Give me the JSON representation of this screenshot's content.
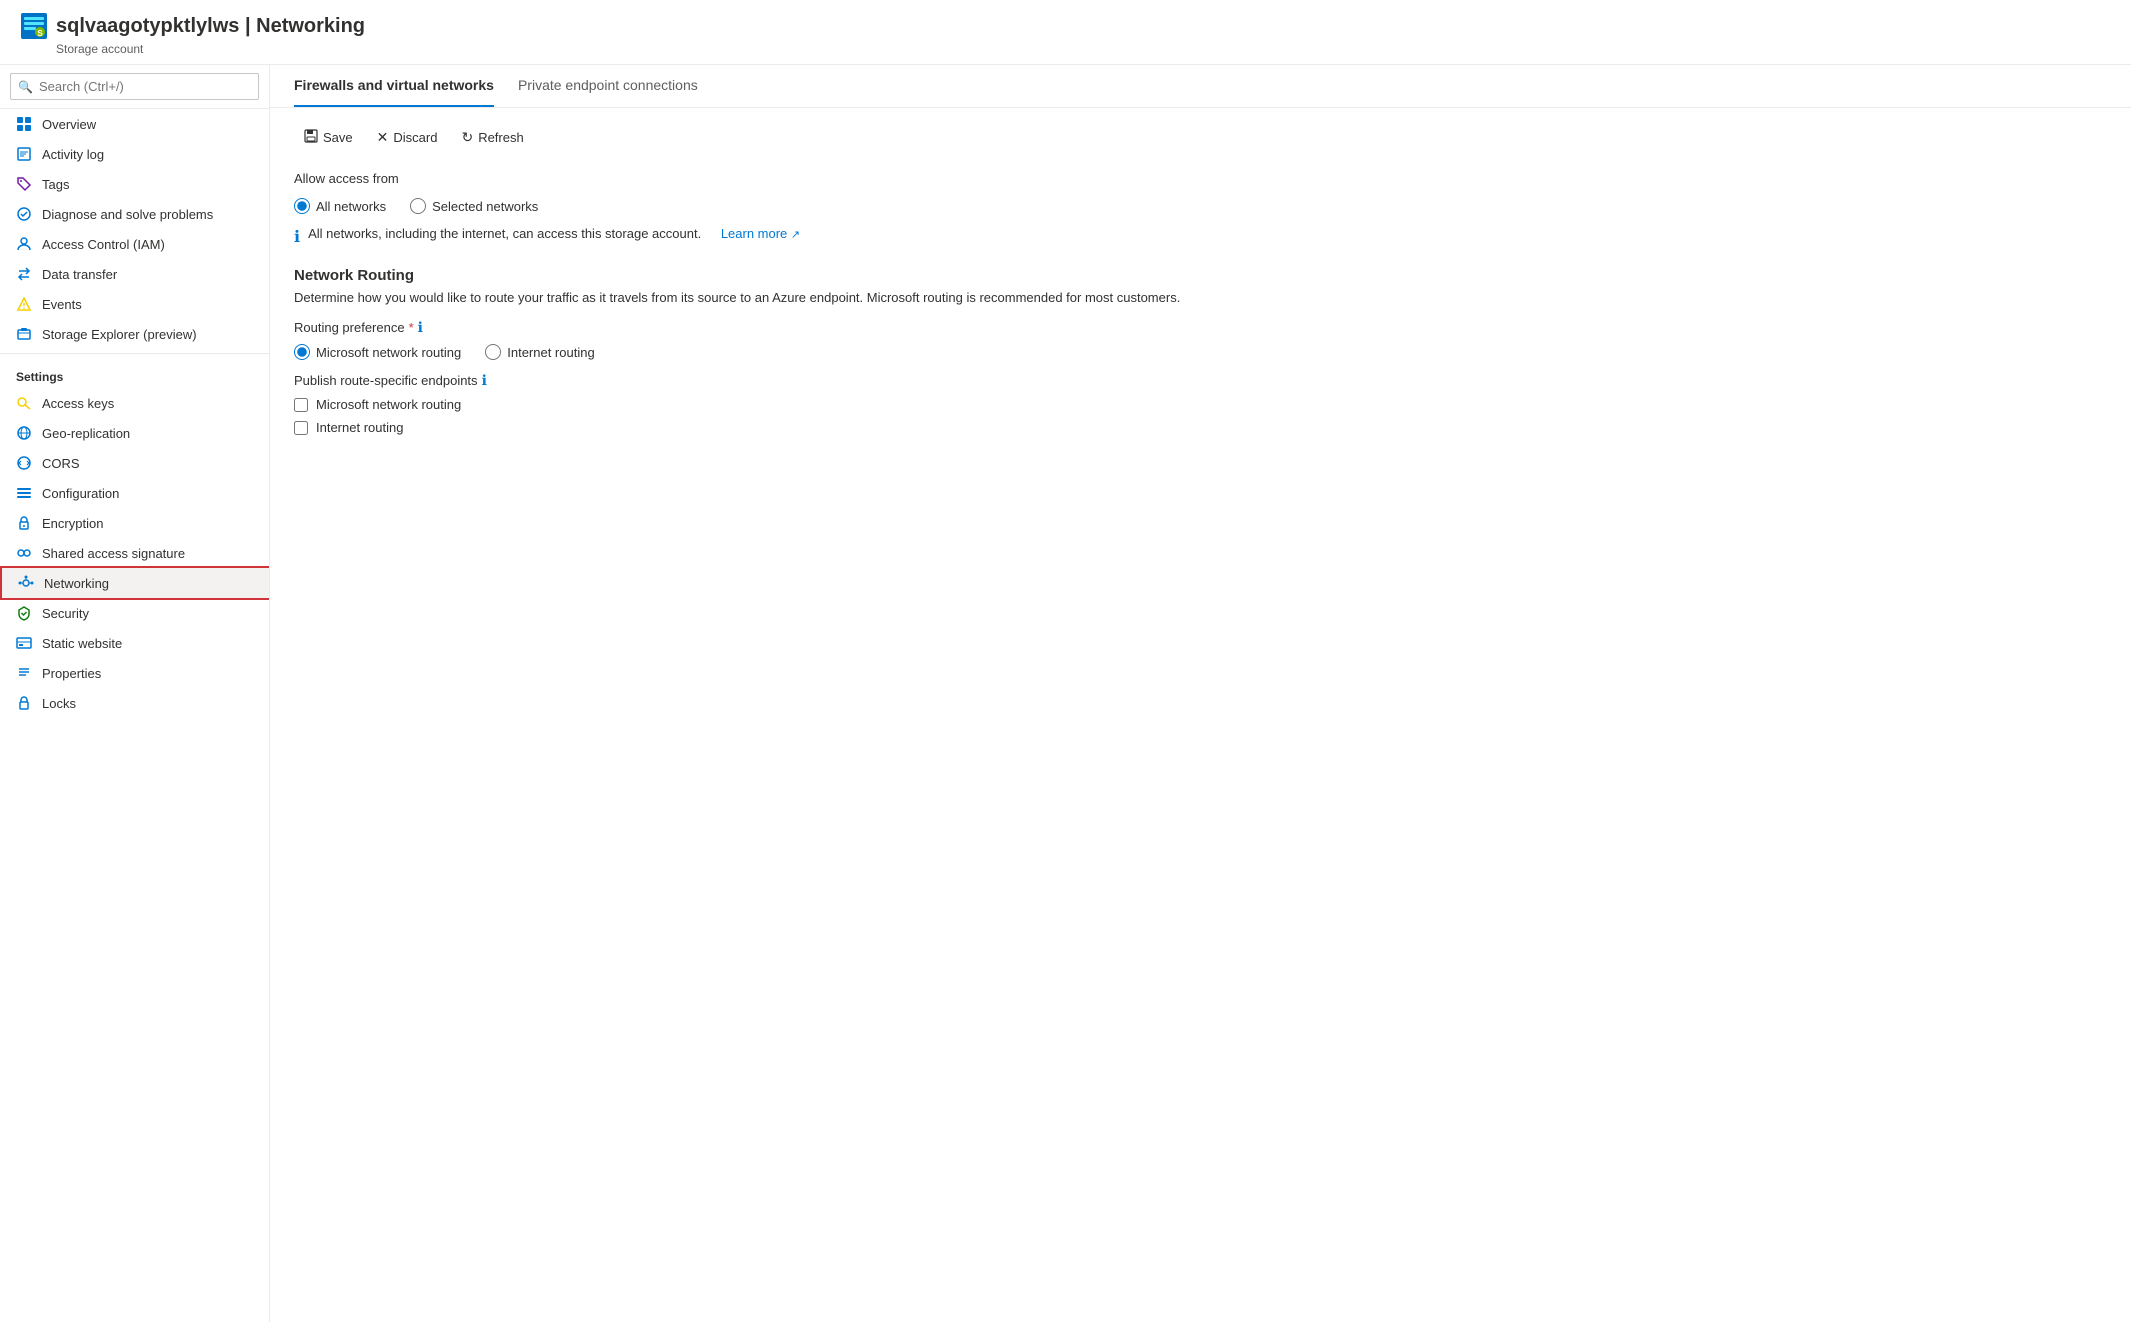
{
  "header": {
    "title": "sqlvaagotypktlylws | Networking",
    "resource_name": "sqlvaagotypktlylws",
    "page_name": "Networking",
    "subtitle": "Storage account",
    "icon": "storage-account"
  },
  "sidebar": {
    "search": {
      "placeholder": "Search (Ctrl+/)"
    },
    "items": [
      {
        "id": "overview",
        "label": "Overview",
        "icon": "overview-icon"
      },
      {
        "id": "activity-log",
        "label": "Activity log",
        "icon": "activity-icon"
      },
      {
        "id": "tags",
        "label": "Tags",
        "icon": "tags-icon"
      },
      {
        "id": "diagnose",
        "label": "Diagnose and solve problems",
        "icon": "diagnose-icon"
      },
      {
        "id": "access-control",
        "label": "Access Control (IAM)",
        "icon": "iam-icon"
      },
      {
        "id": "data-transfer",
        "label": "Data transfer",
        "icon": "data-transfer-icon"
      },
      {
        "id": "events",
        "label": "Events",
        "icon": "events-icon"
      },
      {
        "id": "storage-explorer",
        "label": "Storage Explorer (preview)",
        "icon": "explorer-icon"
      }
    ],
    "settings_label": "Settings",
    "settings_items": [
      {
        "id": "access-keys",
        "label": "Access keys",
        "icon": "key-icon"
      },
      {
        "id": "geo-replication",
        "label": "Geo-replication",
        "icon": "geo-icon"
      },
      {
        "id": "cors",
        "label": "CORS",
        "icon": "cors-icon"
      },
      {
        "id": "configuration",
        "label": "Configuration",
        "icon": "config-icon"
      },
      {
        "id": "encryption",
        "label": "Encryption",
        "icon": "encryption-icon"
      },
      {
        "id": "shared-access",
        "label": "Shared access signature",
        "icon": "sas-icon"
      },
      {
        "id": "networking",
        "label": "Networking",
        "icon": "networking-icon",
        "active": true
      },
      {
        "id": "security",
        "label": "Security",
        "icon": "security-icon"
      },
      {
        "id": "static-website",
        "label": "Static website",
        "icon": "static-icon"
      },
      {
        "id": "properties",
        "label": "Properties",
        "icon": "properties-icon"
      },
      {
        "id": "locks",
        "label": "Locks",
        "icon": "locks-icon"
      }
    ]
  },
  "tabs": [
    {
      "id": "firewalls",
      "label": "Firewalls and virtual networks",
      "active": true
    },
    {
      "id": "private-endpoints",
      "label": "Private endpoint connections",
      "active": false
    }
  ],
  "toolbar": {
    "save_label": "Save",
    "discard_label": "Discard",
    "refresh_label": "Refresh"
  },
  "content": {
    "allow_access_from_label": "Allow access from",
    "radio_all_networks": "All networks",
    "radio_selected_networks": "Selected networks",
    "info_text": "All networks, including the internet, can access this storage account.",
    "learn_more_label": "Learn more",
    "network_routing_heading": "Network Routing",
    "network_routing_description": "Determine how you would like to route your traffic as it travels from its source to an Azure endpoint. Microsoft routing is recommended for most customers.",
    "routing_preference_label": "Routing preference",
    "routing_required": "*",
    "radio_microsoft_routing": "Microsoft network routing",
    "radio_internet_routing": "Internet routing",
    "publish_endpoints_label": "Publish route-specific endpoints",
    "checkbox_microsoft_routing": "Microsoft network routing",
    "checkbox_internet_routing": "Internet routing"
  }
}
